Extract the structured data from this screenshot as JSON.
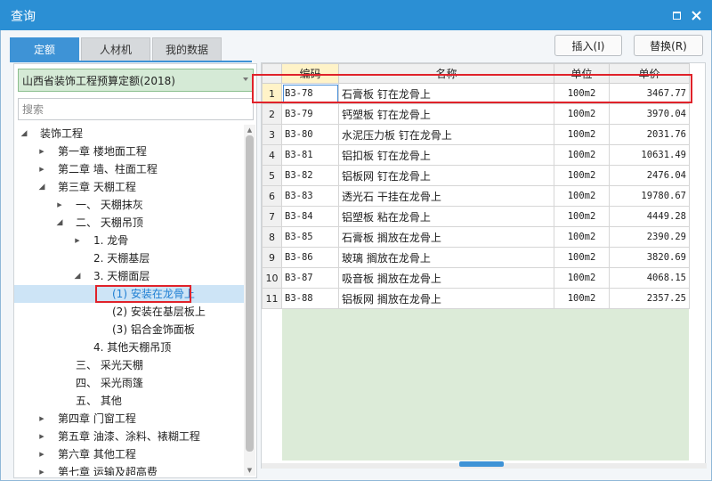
{
  "window": {
    "title": "查询",
    "accent_color": "#2b8fd4",
    "highlight_color": "#e0222a"
  },
  "tabs": [
    {
      "label": "定额",
      "active": true
    },
    {
      "label": "人材机",
      "active": false
    },
    {
      "label": "我的数据",
      "active": false
    }
  ],
  "actions": {
    "insert_label": "插入(I)",
    "replace_label": "替换(R)"
  },
  "quota_selector": {
    "selected": "山西省装饰工程预算定额(2018)"
  },
  "search": {
    "placeholder": "搜索",
    "value": ""
  },
  "tree": [
    {
      "label": "装饰工程",
      "level": 0,
      "expanded": true
    },
    {
      "label": "第一章 楼地面工程",
      "level": 1,
      "expanded": false
    },
    {
      "label": "第二章 墙、柱面工程",
      "level": 1,
      "expanded": false
    },
    {
      "label": "第三章 天棚工程",
      "level": 1,
      "expanded": true
    },
    {
      "label": "一、 天棚抹灰",
      "level": 2,
      "expanded": false
    },
    {
      "label": "二、 天棚吊顶",
      "level": 2,
      "expanded": true
    },
    {
      "label": "1. 龙骨",
      "level": 3,
      "expanded": false
    },
    {
      "label": "2. 天棚基层",
      "level": 3,
      "leaf": true
    },
    {
      "label": "3. 天棚面层",
      "level": 3,
      "expanded": true
    },
    {
      "label": "(1) 安装在龙骨上",
      "level": 4,
      "leaf": true,
      "selected": true
    },
    {
      "label": "(2) 安装在基层板上",
      "level": 4,
      "leaf": true
    },
    {
      "label": "(3) 铝合金饰面板",
      "level": 4,
      "leaf": true
    },
    {
      "label": "4. 其他天棚吊顶",
      "level": 3,
      "leaf": true
    },
    {
      "label": "三、 采光天棚",
      "level": 2,
      "leaf": true
    },
    {
      "label": "四、 采光雨篷",
      "level": 2,
      "leaf": true
    },
    {
      "label": "五、 其他",
      "level": 2,
      "leaf": true
    },
    {
      "label": "第四章 门窗工程",
      "level": 1,
      "expanded": false
    },
    {
      "label": "第五章 油漆、涂料、裱糊工程",
      "level": 1,
      "expanded": false
    },
    {
      "label": "第六章 其他工程",
      "level": 1,
      "expanded": false
    },
    {
      "label": "第七章 运输及超高费",
      "level": 1,
      "expanded": false
    }
  ],
  "table": {
    "columns": [
      "编码",
      "名称",
      "单位",
      "单价"
    ],
    "rows": [
      {
        "no": "1",
        "code": "B3-78",
        "name": "石膏板 钉在龙骨上",
        "unit": "100m2",
        "price": "3467.77",
        "selected": true
      },
      {
        "no": "2",
        "code": "B3-79",
        "name": "钙塑板 钉在龙骨上",
        "unit": "100m2",
        "price": "3970.04"
      },
      {
        "no": "3",
        "code": "B3-80",
        "name": "水泥压力板 钉在龙骨上",
        "unit": "100m2",
        "price": "2031.76"
      },
      {
        "no": "4",
        "code": "B3-81",
        "name": "铝扣板 钉在龙骨上",
        "unit": "100m2",
        "price": "10631.49"
      },
      {
        "no": "5",
        "code": "B3-82",
        "name": "铝板网 钉在龙骨上",
        "unit": "100m2",
        "price": "2476.04"
      },
      {
        "no": "6",
        "code": "B3-83",
        "name": "透光石 干挂在龙骨上",
        "unit": "100m2",
        "price": "19780.67"
      },
      {
        "no": "7",
        "code": "B3-84",
        "name": "铝塑板 粘在龙骨上",
        "unit": "100m2",
        "price": "4449.28"
      },
      {
        "no": "8",
        "code": "B3-85",
        "name": "石膏板 搁放在龙骨上",
        "unit": "100m2",
        "price": "2390.29"
      },
      {
        "no": "9",
        "code": "B3-86",
        "name": "玻璃 搁放在龙骨上",
        "unit": "100m2",
        "price": "3820.69"
      },
      {
        "no": "10",
        "code": "B3-87",
        "name": "吸音板 搁放在龙骨上",
        "unit": "100m2",
        "price": "4068.15"
      },
      {
        "no": "11",
        "code": "B3-88",
        "name": "铝板网 搁放在龙骨上",
        "unit": "100m2",
        "price": "2357.25"
      }
    ]
  }
}
